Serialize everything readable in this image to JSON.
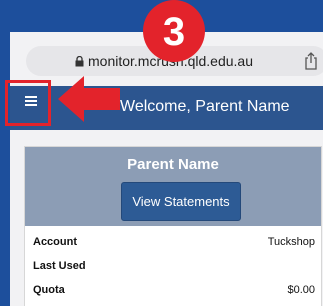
{
  "browser": {
    "url": "monitor.mcrush.qld.edu.au"
  },
  "header": {
    "title": "Welcome, Parent Name"
  },
  "card": {
    "name": "Parent Name",
    "view_statements": "View Statements",
    "rows": [
      {
        "label": "Account",
        "value": "Tuckshop"
      },
      {
        "label": "Last Used",
        "value": ""
      },
      {
        "label": "Quota",
        "value": "$0.00"
      }
    ]
  },
  "annotation": {
    "step": "3",
    "color": "#e3232b"
  },
  "colors": {
    "page_bg": "#1d4f9c",
    "header_bg": "#2c558f",
    "card_head_bg": "#8c9db5",
    "button_bg": "#2d5b95"
  }
}
